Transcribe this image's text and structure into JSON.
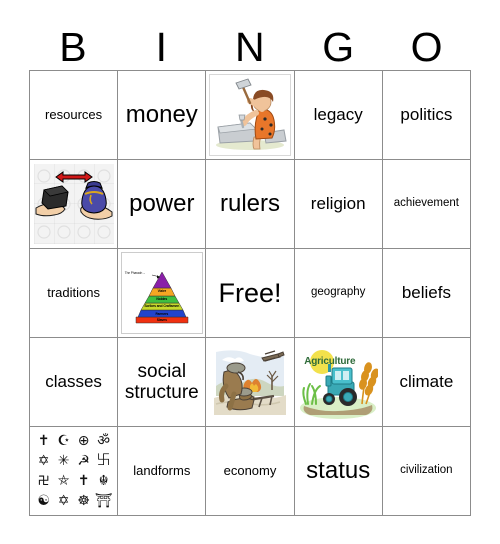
{
  "card": {
    "title": "BINGO",
    "header_letters": [
      "B",
      "I",
      "N",
      "G",
      "O"
    ],
    "free_space_label": "Free!"
  },
  "grid": {
    "rows": 5,
    "columns": 5,
    "cells": [
      [
        {
          "type": "text",
          "label": "resources",
          "size": "sm"
        },
        {
          "type": "text",
          "label": "money",
          "size": "lg"
        },
        {
          "type": "image",
          "label": "technology",
          "icon": "cave-person-chiseling-stone-image"
        },
        {
          "type": "text",
          "label": "legacy",
          "size": "md"
        },
        {
          "type": "text",
          "label": "politics",
          "size": "md"
        }
      ],
      [
        {
          "type": "image",
          "label": "trade",
          "icon": "hands-exchanging-goods-image"
        },
        {
          "type": "text",
          "label": "power",
          "size": "lg"
        },
        {
          "type": "text",
          "label": "rulers",
          "size": "lg"
        },
        {
          "type": "text",
          "label": "religion",
          "size": "md"
        },
        {
          "type": "text",
          "label": "achievement",
          "size": "xs"
        }
      ],
      [
        {
          "type": "text",
          "label": "traditions",
          "size": "sm"
        },
        {
          "type": "image",
          "label": "social pyramid",
          "icon": "egyptian-social-pyramid-image"
        },
        {
          "type": "text",
          "label": "Free!",
          "size": "xl",
          "free": true
        },
        {
          "type": "text",
          "label": "geography",
          "size": "xs"
        },
        {
          "type": "text",
          "label": "beliefs",
          "size": "md"
        }
      ],
      [
        {
          "type": "text",
          "label": "classes",
          "size": "md"
        },
        {
          "type": "text",
          "label": "social structure",
          "size": "two-line",
          "lines": [
            "social",
            "structure"
          ]
        },
        {
          "type": "image",
          "label": "war",
          "icon": "soldiers-machine-gun-biplane-image"
        },
        {
          "type": "image",
          "label": "agriculture",
          "icon": "agriculture-tractor-wheat-image"
        },
        {
          "type": "text",
          "label": "climate",
          "size": "md"
        }
      ],
      [
        {
          "type": "image",
          "label": "world religions",
          "icon": "religious-symbols-grid-image"
        },
        {
          "type": "text",
          "label": "landforms",
          "size": "sm"
        },
        {
          "type": "text",
          "label": "economy",
          "size": "sm"
        },
        {
          "type": "text",
          "label": "status",
          "size": "lg"
        },
        {
          "type": "text",
          "label": "civilization",
          "size": "xs"
        }
      ]
    ]
  },
  "images": {
    "pyramid": {
      "annotation": "The Pharaoh→",
      "tiers": [
        {
          "label": "",
          "color": "#8a1fa8"
        },
        {
          "label": "Vizier",
          "color": "#f5a623"
        },
        {
          "label": "Nobles",
          "color": "#3fbf3f"
        },
        {
          "label": "Scribes and Craftsmen",
          "color": "#c6d92c"
        },
        {
          "label": "Farmers",
          "color": "#2244cc"
        },
        {
          "label": "Slaves",
          "color": "#f03010"
        }
      ]
    },
    "agriculture": {
      "caption": "Agriculture",
      "tractor_color": "#3aa9b5",
      "wheat_color": "#d9921f",
      "grass_color": "#6cbf47",
      "sun_color": "#f2e14c"
    },
    "trade": {
      "arrow_color": "#d01818",
      "bag_color": "#4a4aa8",
      "box_color": "#2b2b2b",
      "skin_color": "#f2cfa8"
    },
    "stone_carver": {
      "tunic_color": "#e8762a",
      "stone_color": "#c9cdd1",
      "hair_color": "#8a4b24"
    },
    "war": {
      "uniform_color": "#9a7b4f",
      "sky_color": "#d9e4ee",
      "fire_color": "#e07820"
    },
    "religion_symbols": [
      "✝",
      "☪",
      "⊕",
      "ॐ",
      "✡",
      "✳",
      "☭",
      "࿕",
      "࿖",
      "⛤",
      "✝",
      "☬",
      "☯",
      "✡",
      "☸",
      "⛩"
    ]
  }
}
